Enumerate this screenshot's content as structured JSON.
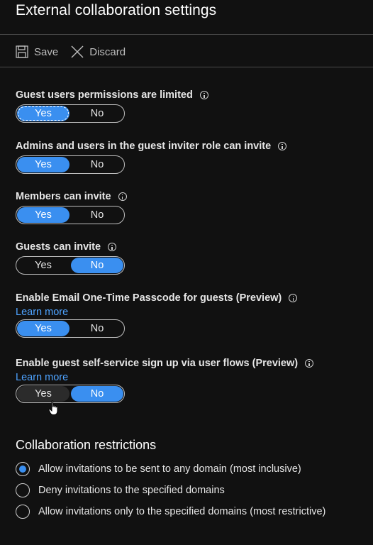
{
  "title": "External collaboration settings",
  "toolbar": {
    "save_label": "Save",
    "discard_label": "Discard"
  },
  "settings": [
    {
      "label": "Guest users permissions are limited",
      "learn_more": "",
      "yes": "Yes",
      "no": "No",
      "selected": "Yes"
    },
    {
      "label": "Admins and users in the guest inviter role can invite",
      "learn_more": "",
      "yes": "Yes",
      "no": "No",
      "selected": "Yes"
    },
    {
      "label": "Members can invite",
      "learn_more": "",
      "yes": "Yes",
      "no": "No",
      "selected": "Yes"
    },
    {
      "label": "Guests can invite",
      "learn_more": "",
      "yes": "Yes",
      "no": "No",
      "selected": "No"
    },
    {
      "label": "Enable Email One-Time Passcode for guests (Preview)",
      "learn_more": "Learn more",
      "yes": "Yes",
      "no": "No",
      "selected": "Yes"
    },
    {
      "label": "Enable guest self-service sign up via user flows (Preview)",
      "learn_more": "Learn more",
      "yes": "Yes",
      "no": "No",
      "selected": "No"
    }
  ],
  "restrictions": {
    "title": "Collaboration restrictions",
    "options": [
      {
        "label": "Allow invitations to be sent to any domain (most inclusive)",
        "checked": true
      },
      {
        "label": "Deny invitations to the specified domains",
        "checked": false
      },
      {
        "label": "Allow invitations only to the specified domains (most restrictive)",
        "checked": false
      }
    ]
  },
  "colors": {
    "accent": "#3a8ff0",
    "link": "#4ea3ff",
    "background": "#111111"
  }
}
